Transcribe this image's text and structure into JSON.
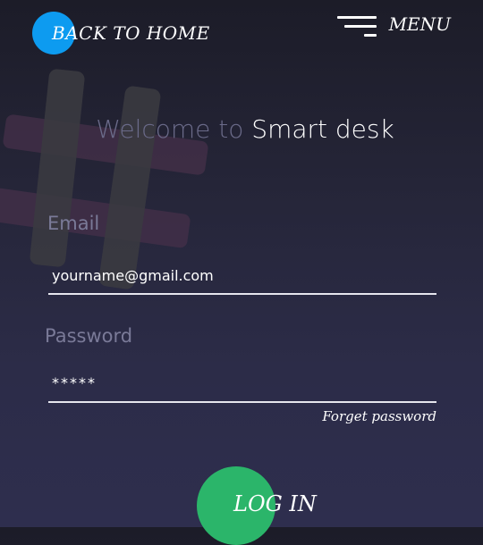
{
  "nav": {
    "back_label": "BACK TO HOME",
    "menu_label": "MENU"
  },
  "welcome": {
    "prefix": "Welcome to",
    "app_name": "Smart desk"
  },
  "form": {
    "email_label": "Email",
    "email_value": "yourname@gmail.com",
    "password_label": "Password",
    "password_value": "*****",
    "forgot_label": "Forget password",
    "login_label": "LOG IN"
  },
  "colors": {
    "back_button": "#0d9bf0",
    "login_button": "#2bb56a",
    "background_top": "#1c1c28",
    "background_bottom": "#2e2e4e"
  },
  "icons": {
    "menu": "hamburger-icon",
    "background": "hash-icon"
  }
}
